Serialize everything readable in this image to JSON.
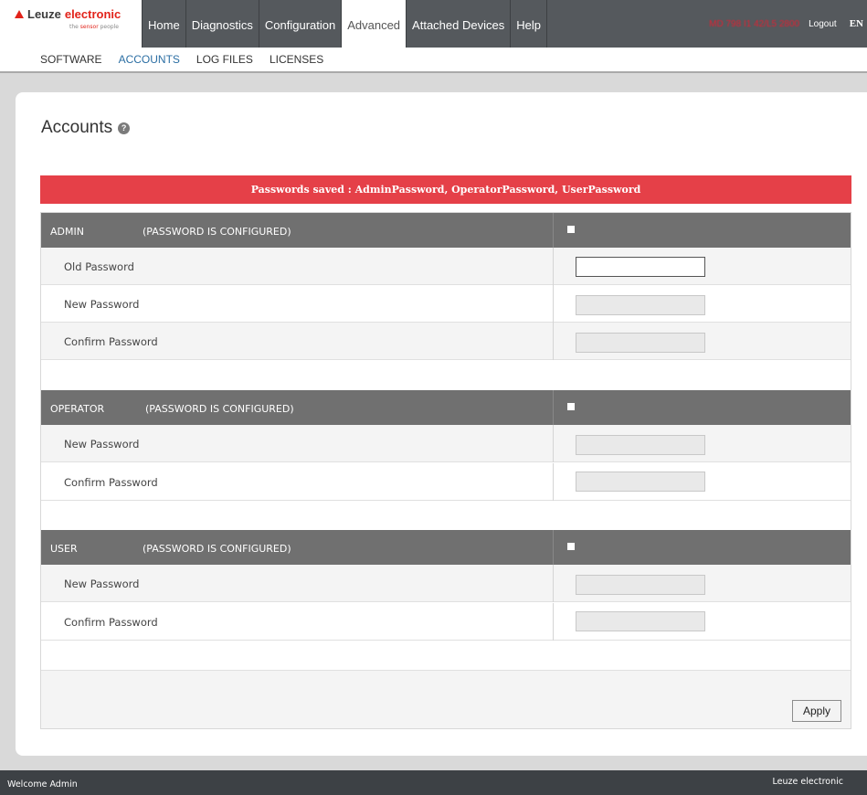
{
  "brand": {
    "name_1": "Leuze",
    "name_2": "electronic",
    "tagline_1": "the",
    "tagline_2": "sensor",
    "tagline_3": "people"
  },
  "nav": {
    "items": [
      "Home",
      "Diagnostics",
      "Configuration",
      "Advanced",
      "Attached Devices",
      "Help"
    ],
    "active": "Advanced"
  },
  "header": {
    "device": "MD 798 I1 42/L5 2800",
    "logout": "Logout",
    "lang": "EN"
  },
  "subnav": {
    "items": [
      "SOFTWARE",
      "ACCOUNTS",
      "LOG FILES",
      "LICENSES"
    ],
    "active": "ACCOUNTS"
  },
  "page": {
    "title": "Accounts"
  },
  "alert": "Passwords saved : AdminPassword, OperatorPassword, UserPassword",
  "sections": {
    "admin": {
      "name": "ADMIN",
      "status": "(PASSWORD IS CONFIGURED)",
      "fields": [
        "Old Password",
        "New Password",
        "Confirm Password"
      ]
    },
    "operator": {
      "name": "OPERATOR",
      "status": "(PASSWORD IS CONFIGURED)",
      "fields": [
        "New Password",
        "Confirm Password"
      ]
    },
    "user": {
      "name": "USER",
      "status": "(PASSWORD IS CONFIGURED)",
      "fields": [
        "New Password",
        "Confirm Password"
      ]
    }
  },
  "apply": "Apply",
  "footer": {
    "left": "Welcome Admin",
    "right": "Leuze electronic"
  },
  "colors": {
    "alert": "#e54048",
    "topbar": "#55595d",
    "section_header": "#707070",
    "footer": "#3d4145",
    "brand_red": "#e2231a"
  }
}
